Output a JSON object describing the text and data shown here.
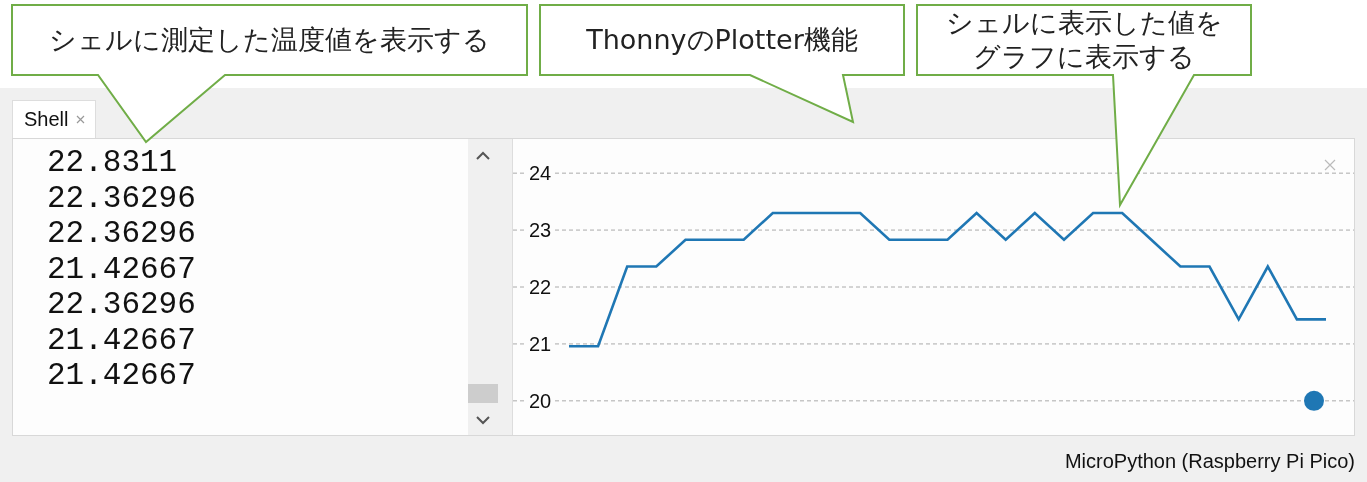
{
  "callouts": [
    {
      "lines": [
        "シェルに測定した温度値を表示する"
      ]
    },
    {
      "lines": [
        "ThonnyのPlotter機能"
      ]
    },
    {
      "lines": [
        "シェルに表示した値を",
        "グラフに表示する"
      ]
    }
  ],
  "tab": {
    "label": "Shell",
    "selected": true
  },
  "shell": {
    "lines": [
      "22.8311",
      "22.36296",
      "22.36296",
      "21.42667",
      "22.36296",
      "21.42667",
      "21.42667"
    ]
  },
  "plotter": {
    "chart_data": {
      "type": "line",
      "grid": true,
      "ylim": [
        20,
        24
      ],
      "yticks": [
        20,
        21,
        22,
        23,
        24
      ],
      "series": [
        {
          "color": "#1f77b4",
          "values": [
            20.96,
            20.96,
            22.36,
            22.36,
            22.83,
            22.83,
            22.83,
            23.3,
            23.3,
            23.3,
            23.3,
            22.83,
            22.83,
            22.83,
            23.3,
            22.83,
            23.3,
            22.83,
            23.3,
            23.3,
            22.83,
            22.36,
            22.36,
            21.43,
            22.36,
            21.43,
            21.43
          ]
        }
      ]
    }
  },
  "status_bar": {
    "text": "MicroPython (Raspberry Pi Pico)"
  }
}
